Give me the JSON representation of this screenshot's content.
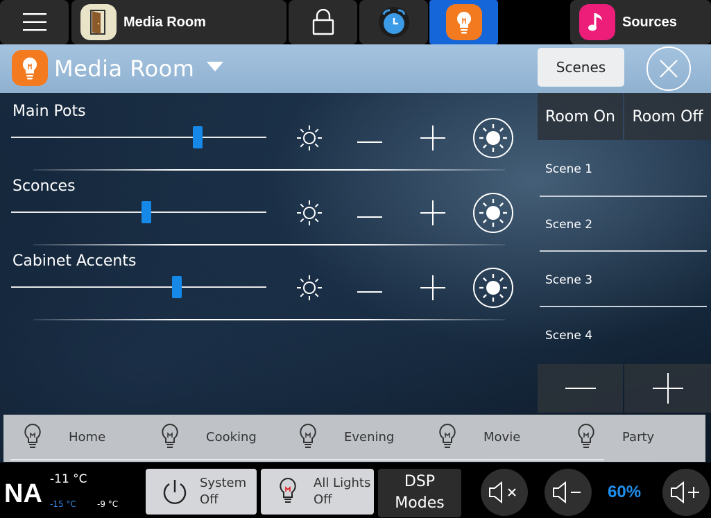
{
  "topbar": {
    "room_label": "Media Room",
    "sources_label": "Sources",
    "icons": [
      "menu-icon",
      "door-icon",
      "lock-icon",
      "clock-icon",
      "lightbulb-icon",
      "music-note-icon"
    ]
  },
  "header": {
    "room_title": "Media Room",
    "scenes_label": "Scenes"
  },
  "loads": [
    {
      "name": "Main Pots",
      "level": 0.73
    },
    {
      "name": "Sconces",
      "level": 0.53
    },
    {
      "name": "Cabinet Accents",
      "level": 0.65
    }
  ],
  "scenes_panel": {
    "room_on": "Room On",
    "room_off": "Room Off",
    "scenes": [
      "Scene 1",
      "Scene 2",
      "Scene 3",
      "Scene 4"
    ]
  },
  "presets": [
    "Home",
    "Cooking",
    "Evening",
    "Movie",
    "Party"
  ],
  "bottombar": {
    "location": "NA",
    "temp_current": "-11 °C",
    "temp_low": "-15 °C",
    "temp_high": "-9 °C",
    "system_off": [
      "System",
      "Off"
    ],
    "all_lights_off": [
      "All Lights",
      "Off"
    ],
    "dsp_modes": [
      "DSP",
      "Modes"
    ],
    "volume": "60%"
  },
  "colors": {
    "accent_blue": "#1588e8",
    "header_blue": "#9ebfdc",
    "lighting_orange": "#f47a1f",
    "sources_pink": "#ec1e79",
    "volume_text": "#1f8ff0"
  }
}
